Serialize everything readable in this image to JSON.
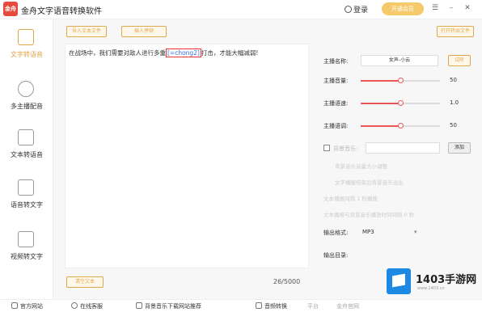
{
  "app": {
    "title": "金舟文字语音转换软件",
    "login": "登录",
    "vip": "开通会员",
    "logo_text": "金舟"
  },
  "sidebar": [
    {
      "label": "文字转语音",
      "active": true
    },
    {
      "label": "多主播配音",
      "active": false
    },
    {
      "label": "文本转语音",
      "active": false
    },
    {
      "label": "语音转文字",
      "active": false
    },
    {
      "label": "视频转文字",
      "active": false
    }
  ],
  "toolbar": {
    "btn1": "导入文本文件",
    "btn2": "插入停顿",
    "btn_right": "打开转出文件"
  },
  "editor": {
    "text_before": "在战场中，我们需要对敌人进行多重",
    "text_highlight": "[=chong2]",
    "text_after": "打击，才能大幅减弱!",
    "clear_label": "清空文本",
    "counter": "26/5000"
  },
  "settings": {
    "anchor_label": "主播名称:",
    "anchor_value": "女声-小云",
    "anchor_btn": "试听",
    "volume_label": "主播音量:",
    "volume_value": "50",
    "speed_label": "主播语速:",
    "speed_value": "1.0",
    "pitch_label": "主播语调:",
    "pitch_value": "50",
    "bgm_label": "背景音乐:",
    "bgm_add": "添加",
    "faint1": "背景音乐音量大小调整",
    "faint2": "文字播报结束后背景音乐淡出",
    "faint3": "文本播报间隔 1 秒播报",
    "faint4": "文本播报与背景音乐播放时间间隔 0 秒",
    "format_label": "输出格式:",
    "format_value": "MP3",
    "output_label": "输出目录:"
  },
  "bottombar": {
    "i1": "官方网站",
    "i2": "在线客服",
    "i3": "背景音乐下载网站推荐",
    "i4": "音频转换",
    "i5": "平台",
    "i6": "金舟官网"
  },
  "watermark": {
    "title": "1403手游网",
    "sub": "www.1403.cn"
  },
  "levels": {
    "volume": 0.5,
    "speed": 0.5,
    "pitch": 0.5
  }
}
